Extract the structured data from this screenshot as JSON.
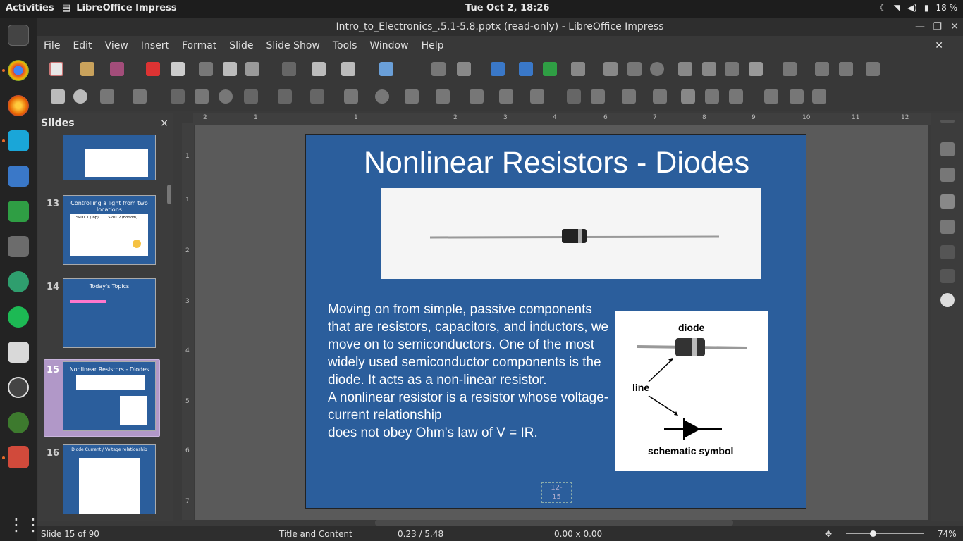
{
  "topbar": {
    "activities": "Activities",
    "app_name": "LibreOffice Impress",
    "clock": "Tue Oct  2, 18:26",
    "battery": "18 %"
  },
  "window": {
    "title": "Intro_to_Electronics_.5.1-5.8.pptx (read-only) - LibreOffice Impress"
  },
  "menu": [
    "File",
    "Edit",
    "View",
    "Insert",
    "Format",
    "Slide",
    "Slide Show",
    "Tools",
    "Window",
    "Help"
  ],
  "slides_pane": {
    "title": "Slides",
    "close": "×",
    "items": [
      {
        "num": "13",
        "title": "Controlling a light from two locations",
        "labels": [
          "SPDT 1 (Top)",
          "SPDT 2 (Bottom)"
        ]
      },
      {
        "num": "14",
        "title": "Today's Topics"
      },
      {
        "num": "15",
        "title": "Nonlinear Resistors - Diodes"
      },
      {
        "num": "16",
        "title": "Diode Current / Voltage relationship"
      }
    ]
  },
  "ruler": {
    "h_ticks": [
      "2",
      "1",
      "1",
      "1",
      "2",
      "3",
      "4",
      "5",
      "6",
      "7",
      "8",
      "9",
      "10",
      "11",
      "12"
    ],
    "v_ticks": [
      "1",
      "1",
      "2",
      "3",
      "4",
      "5",
      "6",
      "7"
    ]
  },
  "slide": {
    "title": "Nonlinear Resistors - Diodes",
    "body": "Moving on from simple, passive components that are resistors, capacitors, and inductors, we move on to semiconductors. One of the most widely used semiconductor components is the diode. It acts as a non-linear resistor.\nA nonlinear resistor is a resistor whose voltage-current relationship\ndoes not obey Ohm's law of V = IR.",
    "diagram": {
      "diode": "diode",
      "line": "line",
      "schematic": "schematic symbol"
    },
    "slide_number": "12-\n15"
  },
  "status": {
    "slide": "Slide 15 of 90",
    "layout": "Title and Content",
    "position": "0.23 / 5.48",
    "size": "0.00 x 0.00",
    "zoom": "74%"
  },
  "colors": {
    "slide_bg": "#2b5e9c",
    "selection": "#b198c8"
  }
}
